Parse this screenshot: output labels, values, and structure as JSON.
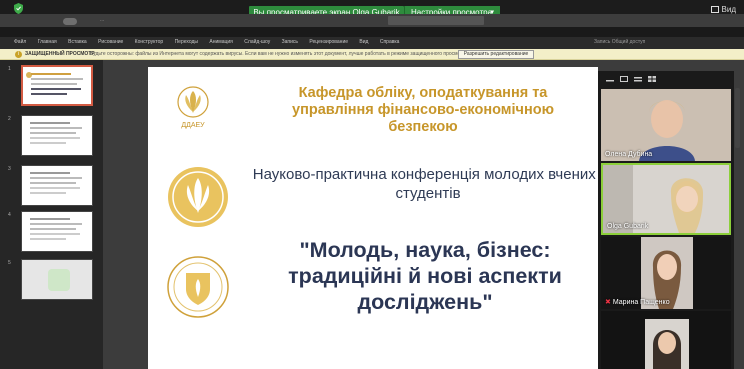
{
  "zoom": {
    "share_banner": "Вы просматриваете экран Olga Gubarik",
    "view_options": "Настройки просмотра",
    "view_label": "Вид"
  },
  "ppt": {
    "title_filename": "...",
    "ribbon_tabs": [
      "Файл",
      "Главная",
      "Вставка",
      "Рисование",
      "Конструктор",
      "Переходы",
      "Анимация",
      "Слайд-шоу",
      "Запись",
      "Рецензирование",
      "Вид",
      "Справка"
    ],
    "ribbon_right": "Запись   Общий доступ",
    "protected_label": "ЗАЩИЩЕННЫЙ ПРОСМОТР",
    "protected_msg": "Будьте осторожны: файлы из Интернета могут содержать вирусы. Если вам не нужно изменять этот документ, лучше работать в режиме защищенного просмотра.",
    "protected_button": "Разрешить редактирование"
  },
  "thumbnails": [
    "1",
    "2",
    "3",
    "4",
    "5"
  ],
  "slide": {
    "logo_caption": "ДДАЕУ",
    "department": "Кафедра обліку, оподаткування та управління фінансово-економічною безпекою",
    "conference": "Науково-практична конференція молодих вчених і студентів",
    "theme": "\"Молодь, наука, бізнес: традиційні й нові аспекти досліджень\""
  },
  "participants": [
    {
      "name": "Олена Дубина",
      "muted": false
    },
    {
      "name": "Olga Gubarik",
      "muted": false
    },
    {
      "name": "Марина Пащенко",
      "muted": true
    },
    {
      "name": "",
      "muted": false
    }
  ],
  "colors": {
    "zoom_green": "#2e8b3d",
    "active_border": "#8ccf3a",
    "dept_gold": "#c7962a",
    "title_navy": "#2b3654"
  }
}
